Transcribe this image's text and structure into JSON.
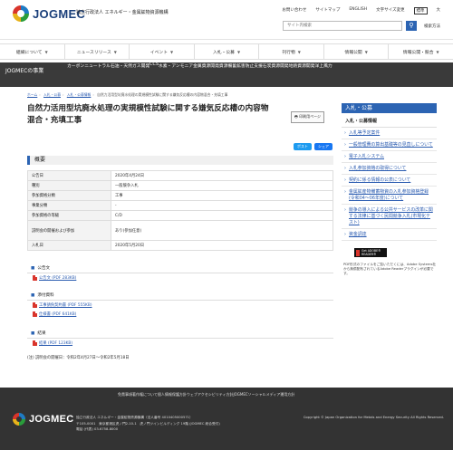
{
  "header": {
    "logo_text": "JOGMEC",
    "org_name": "独立行政法人 エネルギー・金属鉱物資源機構",
    "util_links": [
      "お問い合わせ",
      "サイトマップ",
      "ENGLISH",
      "文字サイズ変更",
      "標準",
      "大"
    ],
    "search_placeholder": "サイト内検索",
    "search_icon": "magnifier-icon",
    "sitemap_label": "検索方法"
  },
  "gnav": [
    "組織について",
    "ニュースリリース",
    "イベント",
    "入札・公募",
    "刊行物",
    "情報公開",
    "情報公開・競合"
  ],
  "subnav": {
    "title": "JOGMECの事業",
    "links": [
      "カーボンニュートラル",
      "石油・天然ガス開発",
      "CCS",
      "水素・アンモニア",
      "金属資源開発",
      "資源備蓄",
      "鉱害防止支援",
      "石炭資源開発",
      "地熱資源開発",
      "洋上風力"
    ]
  },
  "breadcrumb": {
    "items": [
      "ホーム",
      "入札・公募",
      "入札・公募情報",
      "自然力活用型坑廃水処理の実規模性試験に関する嫌気反応槽の内容物混合・充填工事"
    ]
  },
  "main": {
    "title": "自然力活用型坑廃水処理の実規模性試験に関する嫌気反応槽の内容物混合・充填工事",
    "print_label": "印刷用ページ",
    "sns_post": "ポスト",
    "sns_fb": "シェア",
    "summary_heading": "概要",
    "summary_rows": [
      {
        "k": "公告日",
        "v": "2020年4月24日"
      },
      {
        "k": "種別",
        "v": "一般競争入札"
      },
      {
        "k": "参加資格分類",
        "v": "工事"
      },
      {
        "k": "事業分類",
        "v": "-"
      },
      {
        "k": "参加資格の等級",
        "v": "C/D"
      },
      {
        "k": "説明会の開催および参加",
        "v": "あり(参加任意)"
      },
      {
        "k": "入札日",
        "v": "2020年5月20日"
      }
    ],
    "notice_heading": "公告文",
    "notice_files": [
      "公告文 (PDF 283KB)"
    ],
    "attach_heading": "添付資料",
    "attach_files": [
      "工事請負契約書 (PDF 555KB)",
      "仕様書 (PDF 641KB)"
    ],
    "result_heading": "結果",
    "result_files": [
      "結果 (PDF 123KB)"
    ],
    "note": "(注) 説明会の開催日：令和2年4月27日～令和2年5月18日"
  },
  "sidebar": {
    "head": "入札・公募",
    "sub": "入札・公募情報",
    "items": [
      "入札等予定案件",
      "一般管理費の算出基礎等の見直しについて",
      "電子入札システム",
      "入札参加資格の取得について",
      "契約に係る情報の公表について",
      "金属鉱産物備蓄物資の入札参加資格登録(令和04〜06年度)について",
      "競争の導入による公共サービスの改革に関する法律に基づく民間競争入札(市場化テスト)",
      "資金調達"
    ],
    "reader_badge": "Get ADOBE® READER®",
    "reader_note": "PDF形式のファイルをご覧いただくには、Adobe Systems社から無償配布されているAdobe Readerプラグインが必要です。"
  },
  "footer": {
    "links": [
      "免責事項",
      "著作権について",
      "個人情報保護方針",
      "ウェブアクセシビリティ方針",
      "JOGMECソーシャルメディア運用方針"
    ],
    "logo_text": "JOGMEC",
    "address": [
      "独立行政法人 エネルギー・金属鉱物資源機構（法人番号 4010405000571）",
      "〒105-0001　東京都港区虎ノ門2-10-1　虎ノ門ツインビルディング 19階 (JOGMEC 総合受付)",
      "電話 (代表) 03-6758-8000"
    ],
    "copyright": "Copyright © Japan Organization for Metals and Energy Security All Rights Reserved."
  },
  "colors": {
    "accent": "#2c64b3",
    "subnav_bg": "#3a3a3a",
    "footer_bg": "#333333"
  }
}
